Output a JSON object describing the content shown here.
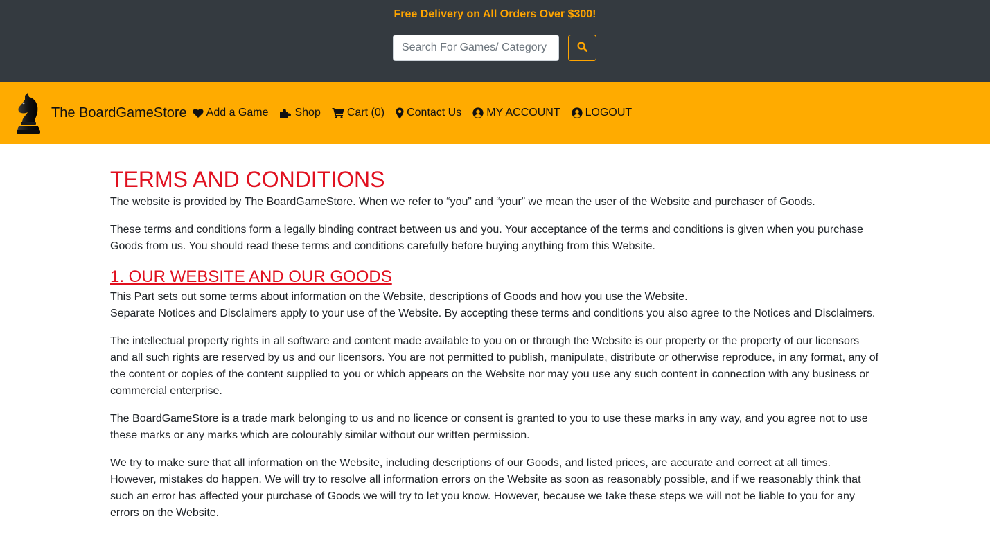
{
  "topbar": {
    "promo": "Free Delivery on All Orders Over $300!",
    "search_placeholder": "Search For Games/ Category",
    "search_icon": "search-icon"
  },
  "navbar": {
    "brand_text": "The BoardGameStore",
    "brand_icon": "chess-knight-logo",
    "items": [
      {
        "label": "Add a Game",
        "icon": "heart-icon"
      },
      {
        "label": "Shop",
        "icon": "puzzle-icon"
      },
      {
        "label": "Cart (0)",
        "icon": "cart-icon"
      },
      {
        "label": "Contact Us",
        "icon": "map-marker-icon"
      },
      {
        "label": "MY ACCOUNT",
        "icon": "user-circle-icon"
      },
      {
        "label": "LOGOUT",
        "icon": "user-circle-icon"
      }
    ]
  },
  "colors": {
    "topbar_bg": "#343a40",
    "promo": "#ffa500",
    "navbar_bg": "#ffab00",
    "heading_red": "#e0101f"
  },
  "content": {
    "title": "TERMS AND CONDITIONS",
    "intro": [
      "The website is provided by The BoardGameStore. When we refer to “you” and “your” we mean the user of the Website and purchaser of Goods.",
      "These terms and conditions form a legally binding contract between us and you. Your acceptance of the terms and conditions is given when you purchase Goods from us. You should read these terms and conditions carefully before buying anything from this Website."
    ],
    "section1": {
      "title": "1. OUR WEBSITE AND OUR GOODS",
      "line1": "This Part sets out some terms about information on the Website, descriptions of Goods and how you use the Website.",
      "line2": "Separate Notices and Disclaimers apply to your use of the Website. By accepting these terms and conditions you also agree to the Notices and Disclaimers.",
      "paragraphs": [
        "The intellectual property rights in all software and content made available to you on or through the Website is our property or the property of our licensors and all such rights are reserved by us and our licensors. You are not permitted to publish, manipulate, distribute or otherwise reproduce, in any format, any of the content or copies of the content supplied to you or which appears on the Website nor may you use any such content in connection with any business or commercial enterprise.",
        "The BoardGameStore is a trade mark belonging to us and no licence or consent is granted to you to use these marks in any way, and you agree not to use these marks or any marks which are colourably similar without our written permission.",
        "We try to make sure that all information on the Website, including descriptions of our Goods, and listed prices, are accurate and correct at all times. However, mistakes do happen. We will try to resolve all information errors on the Website as soon as reasonably possible, and if we reasonably think that such an error has affected your purchase of Goods we will try to let you know. However, because we take these steps we will not be liable to you for any errors on the Website."
      ]
    }
  }
}
